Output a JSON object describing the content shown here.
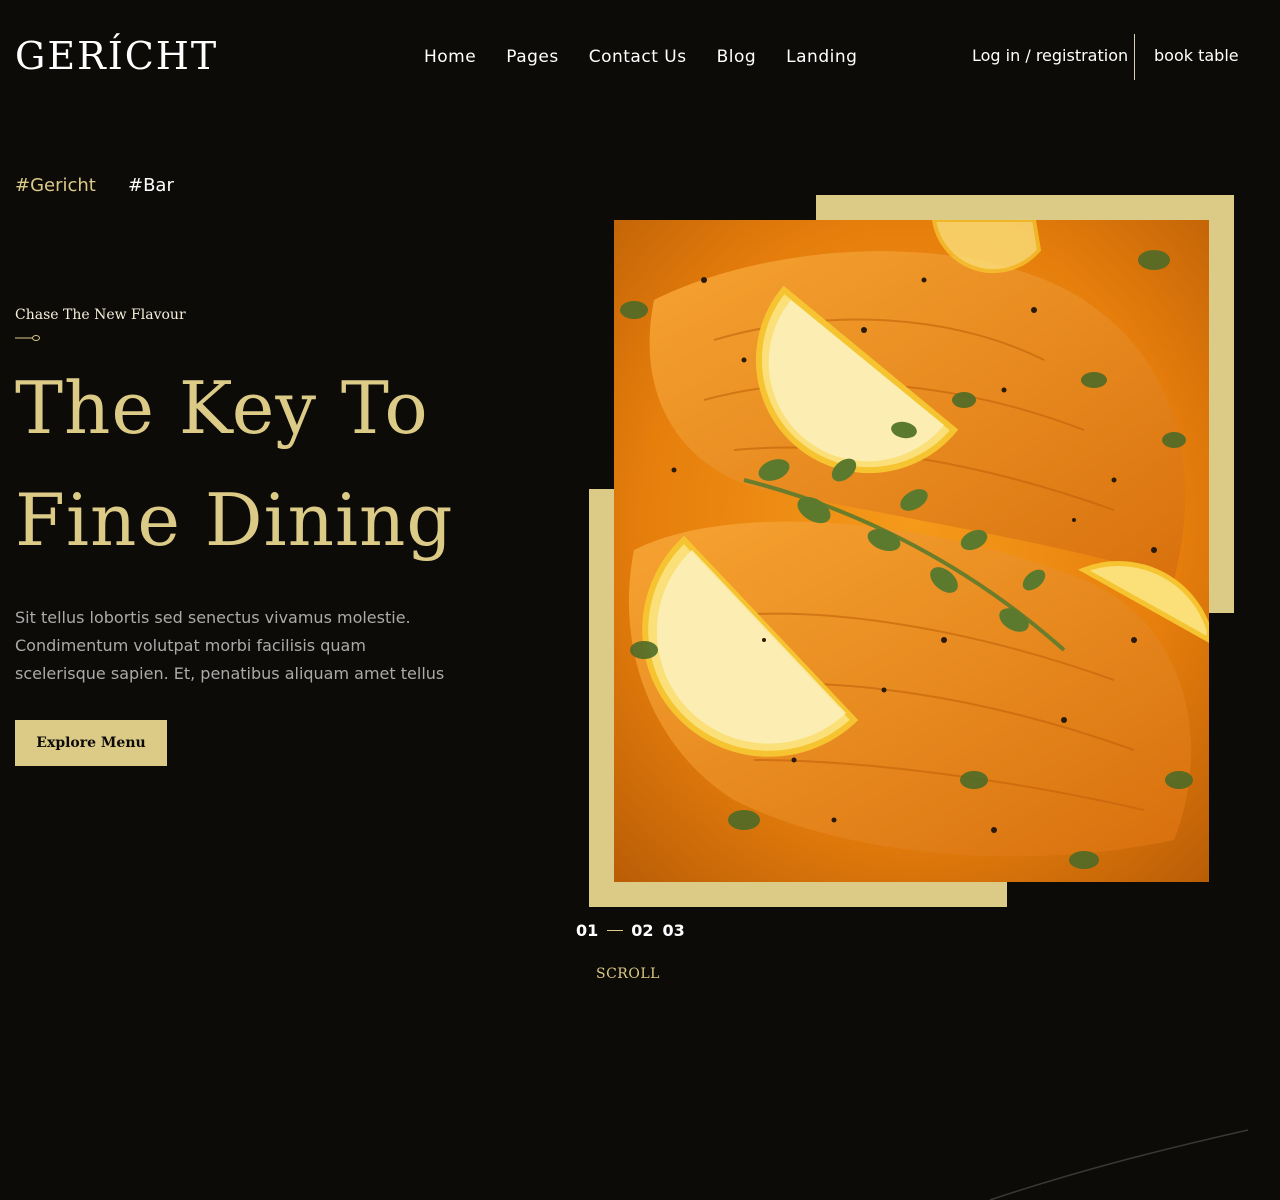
{
  "header": {
    "logo": "GERÍCHT",
    "nav": [
      "Home",
      "Pages",
      "Contact Us",
      "Blog",
      "Landing"
    ],
    "auth": "Log in / registration",
    "book": "book table"
  },
  "tags": [
    "#Gericht",
    "#Bar"
  ],
  "hero": {
    "subtitle": "Chase The New Flavour",
    "headline_line1": "The Key To",
    "headline_line2": "Fine Dining",
    "description": "Sit tellus lobortis sed senectus vivamus molestie. Condimentum volutpat morbi facilisis quam scelerisque sapien. Et, penatibus aliquam amet tellus",
    "cta": "Explore Menu"
  },
  "slider": {
    "slides": [
      "01",
      "02",
      "03"
    ],
    "scroll_label": "SCROLL"
  },
  "colors": {
    "background": "#0c0b08",
    "accent": "#dcca87",
    "muted_text": "#aaaaaa"
  }
}
